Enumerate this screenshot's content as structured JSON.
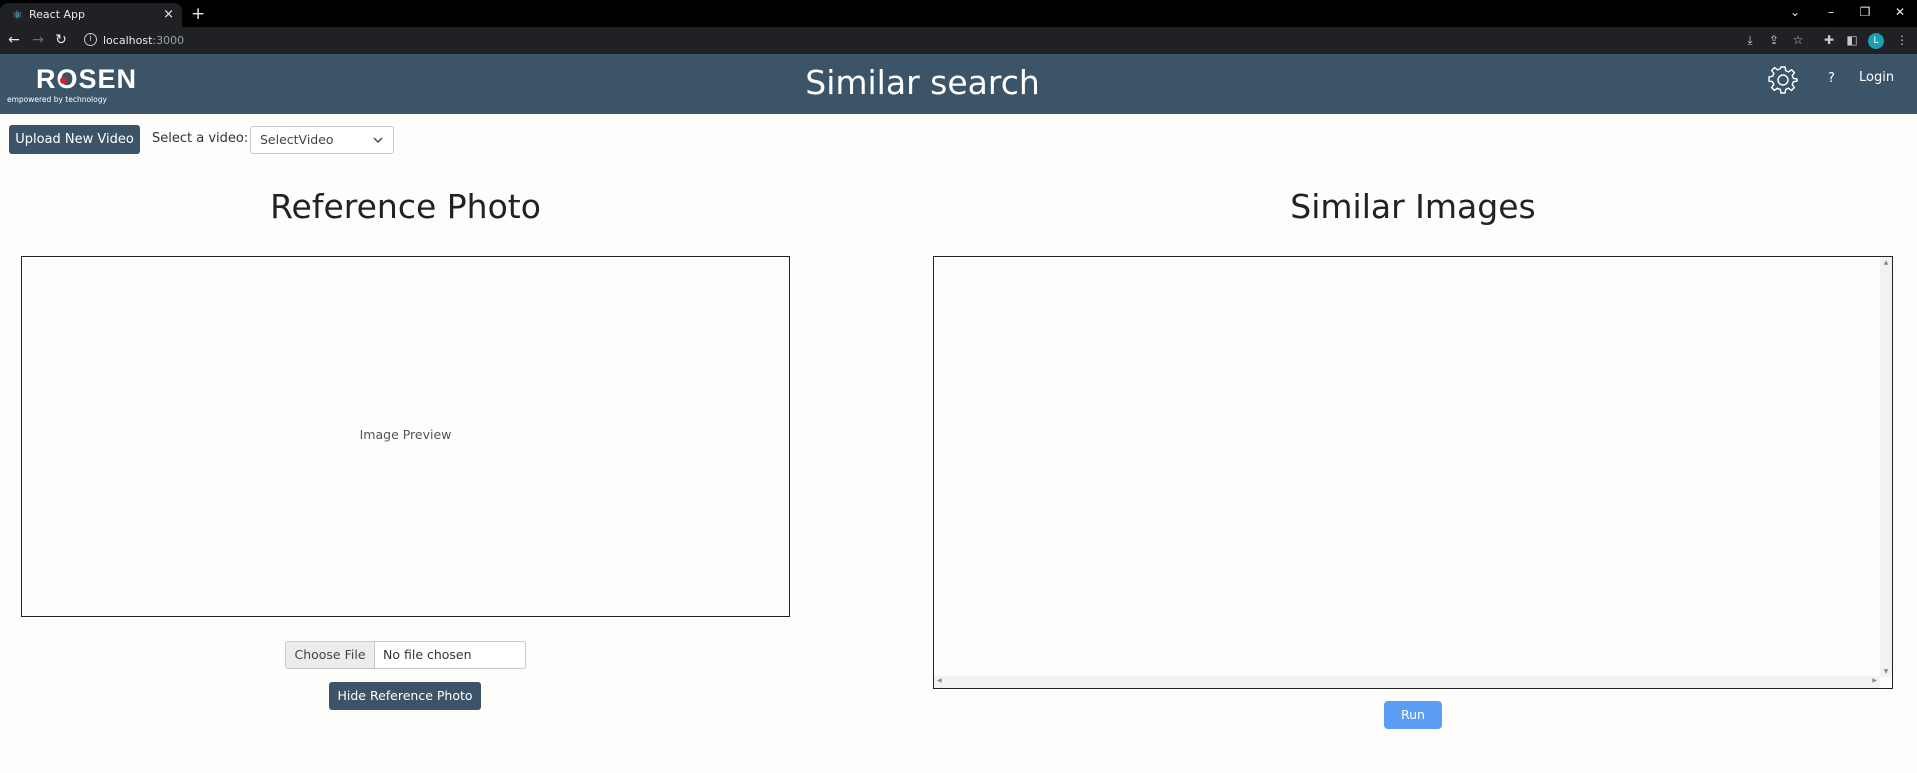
{
  "browser": {
    "tab_title": "React App",
    "new_tab_symbol": "+",
    "tab_close_symbol": "×",
    "url_host": "localhost",
    "url_port": ":3000",
    "avatar_letter": "L"
  },
  "header": {
    "logo_text": "ROSEN",
    "logo_tagline": "empowered by technology",
    "title": "Similar search",
    "help_label": "?",
    "login_label": "Login"
  },
  "controls": {
    "upload_label": "Upload New Video",
    "select_label": "Select a video:",
    "select_value": "SelectVideo"
  },
  "reference": {
    "title": "Reference Photo",
    "preview_text": "Image Preview",
    "choose_file_label": "Choose File",
    "no_file_text": "No file chosen",
    "hide_label": "Hide Reference Photo"
  },
  "similar": {
    "title": "Similar Images",
    "run_label": "Run"
  },
  "colors": {
    "header_bg": "#3c5468",
    "run_button": "#5b9ef5",
    "logo_accent": "#d8202a"
  }
}
